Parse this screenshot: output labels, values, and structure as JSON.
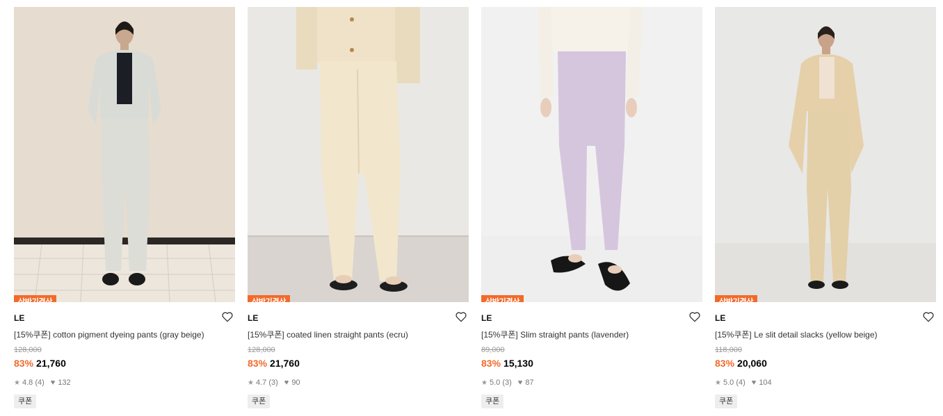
{
  "products": [
    {
      "tag": "상반기결산",
      "brand": "LE",
      "name": "[15%쿠폰] cotton pigment dyeing pants (gray beige)",
      "original_price": "128,000",
      "discount": "83%",
      "price": "21,760",
      "rating": "4.8",
      "review_count": "(4)",
      "likes": "132",
      "coupon": "쿠폰"
    },
    {
      "tag": "상반기결산",
      "brand": "LE",
      "name": "[15%쿠폰] coated linen straight pants (ecru)",
      "original_price": "128,000",
      "discount": "83%",
      "price": "21,760",
      "rating": "4.7",
      "review_count": "(3)",
      "likes": "90",
      "coupon": "쿠폰"
    },
    {
      "tag": "상반기결산",
      "brand": "LE",
      "name": "[15%쿠폰] Slim straight pants (lavender)",
      "original_price": "89,000",
      "discount": "83%",
      "price": "15,130",
      "rating": "5.0",
      "review_count": "(3)",
      "likes": "87",
      "coupon": "쿠폰"
    },
    {
      "tag": "상반기결산",
      "brand": "LE",
      "name": "[15%쿠폰] Le slit detail slacks (yellow beige)",
      "original_price": "118,000",
      "discount": "83%",
      "price": "20,060",
      "rating": "5.0",
      "review_count": "(4)",
      "likes": "104",
      "coupon": "쿠폰"
    }
  ],
  "icons": {
    "wishlist": "heart-outline-icon",
    "rating": "star-icon",
    "likes": "heart-filled-icon"
  },
  "colors": {
    "accent": "#f26a2a",
    "coupon_bg": "#eeeeee"
  }
}
